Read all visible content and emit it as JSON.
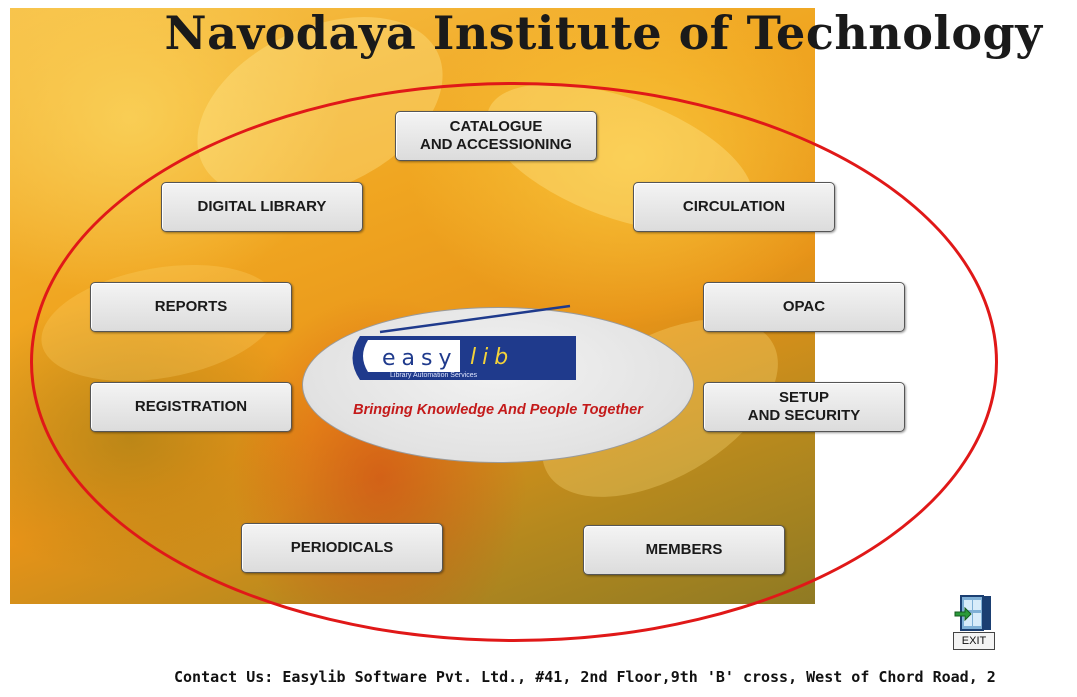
{
  "header": {
    "title": "Navodaya Institute of Technology"
  },
  "menu": {
    "catalogue": "CATALOGUE\nAND ACCESSIONING",
    "digital_library": "DIGITAL LIBRARY",
    "circulation": "CIRCULATION",
    "reports": "REPORTS",
    "opac": "OPAC",
    "registration": "REGISTRATION",
    "setup_security": "SETUP\nAND SECURITY",
    "periodicals": "PERIODICALS",
    "members": "MEMBERS"
  },
  "logo": {
    "brand_prefix": "easy",
    "brand_suffix": "lib",
    "subtitle": "Library Automation Services",
    "tagline": "Bringing Knowledge And People Together",
    "colors": {
      "brand_blue": "#1f3a8c",
      "tagline_red": "#c41a1a"
    }
  },
  "exit": {
    "label": "EXIT",
    "icon": "door-exit-icon"
  },
  "footer": {
    "contact": "Contact Us: Easylib Software Pvt. Ltd., #41, 2nd  Floor,9th 'B' cross, West of Chord Road, 2"
  },
  "colors": {
    "ring": "#e01818",
    "background": "#ffffff"
  }
}
